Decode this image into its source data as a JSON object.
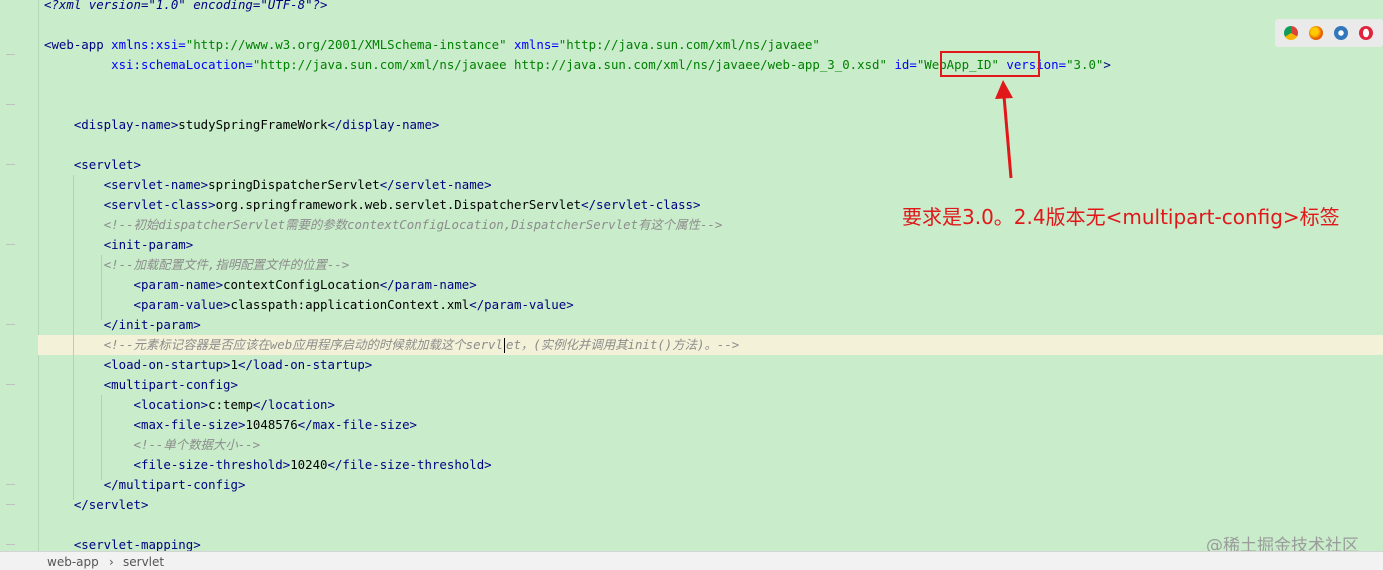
{
  "code": {
    "xml_decl": "<?xml version=\"1.0\" encoding=\"UTF-8\"?>",
    "webapp_open": {
      "tag": "<web-app",
      "a1": "xmlns:xsi=",
      "v1": "\"http://www.w3.org/2001/XMLSchema-instance\"",
      "a2": "xmlns=",
      "v2": "\"http://java.sun.com/xml/ns/javaee\""
    },
    "webapp_open2": {
      "a1": "xsi:schemaLocation=",
      "v1": "\"http://java.sun.com/xml/ns/javaee http://java.sun.com/xml/ns/javaee/web-app_3_0.xsd\"",
      "a2": "id=",
      "v2": "\"WebApp_ID\"",
      "a3": "version=",
      "v3": "\"3.0\"",
      "close": ">"
    },
    "display_name": {
      "open": "<display-name>",
      "text": "studySpringFrameWork",
      "close": "</display-name>"
    },
    "servlet_open": "<servlet>",
    "servlet_name": {
      "open": "<servlet-name>",
      "text": "springDispatcherServlet",
      "close": "</servlet-name>"
    },
    "servlet_class": {
      "open": "<servlet-class>",
      "text": "org.springframework.web.servlet.DispatcherServlet",
      "close": "</servlet-class>"
    },
    "comment1": "<!--初始dispatcherServlet需要的参数contextConfigLocation,DispatcherServlet有这个属性-->",
    "init_param_open": "<init-param>",
    "comment2": "<!--加载配置文件,指明配置文件的位置-->",
    "param_name": {
      "open": "<param-name>",
      "text": "contextConfigLocation",
      "close": "</param-name>"
    },
    "param_value": {
      "open": "<param-value>",
      "text": "classpath:applicationContext.xml",
      "close": "</param-value>"
    },
    "init_param_close": "</init-param>",
    "comment3a": "<!--元素标记容器是否应该在web应用程序启动的时候就加载这个servl",
    "comment3b": "et，(实例化并调用其init()方法)。-->",
    "load_on_startup": {
      "open": "<load-on-startup>",
      "text": "1",
      "close": "</load-on-startup>"
    },
    "multipart_open": "<multipart-config>",
    "location": {
      "open": "<location>",
      "text": "c:temp",
      "close": "</location>"
    },
    "max_file_size": {
      "open": "<max-file-size>",
      "text": "1048576",
      "close": "</max-file-size>"
    },
    "comment4": "<!--单个数据大小-->",
    "file_size_threshold": {
      "open": "<file-size-threshold>",
      "text": "10240",
      "close": "</file-size-threshold>"
    },
    "multipart_close": "</multipart-config>",
    "servlet_close": "</servlet>",
    "servlet_mapping_open": "<servlet-mapping>"
  },
  "annotation": {
    "text": "要求是3.0。2.4版本无<multipart-config>标签",
    "color": "#e1171a"
  },
  "browser_icons": [
    "chrome-icon",
    "firefox-icon",
    "edge-icon",
    "opera-icon"
  ],
  "status_bar": {
    "crumb1": "web-app",
    "separator": "›",
    "crumb2": "servlet"
  },
  "watermark": "@稀土掘金技术社区"
}
